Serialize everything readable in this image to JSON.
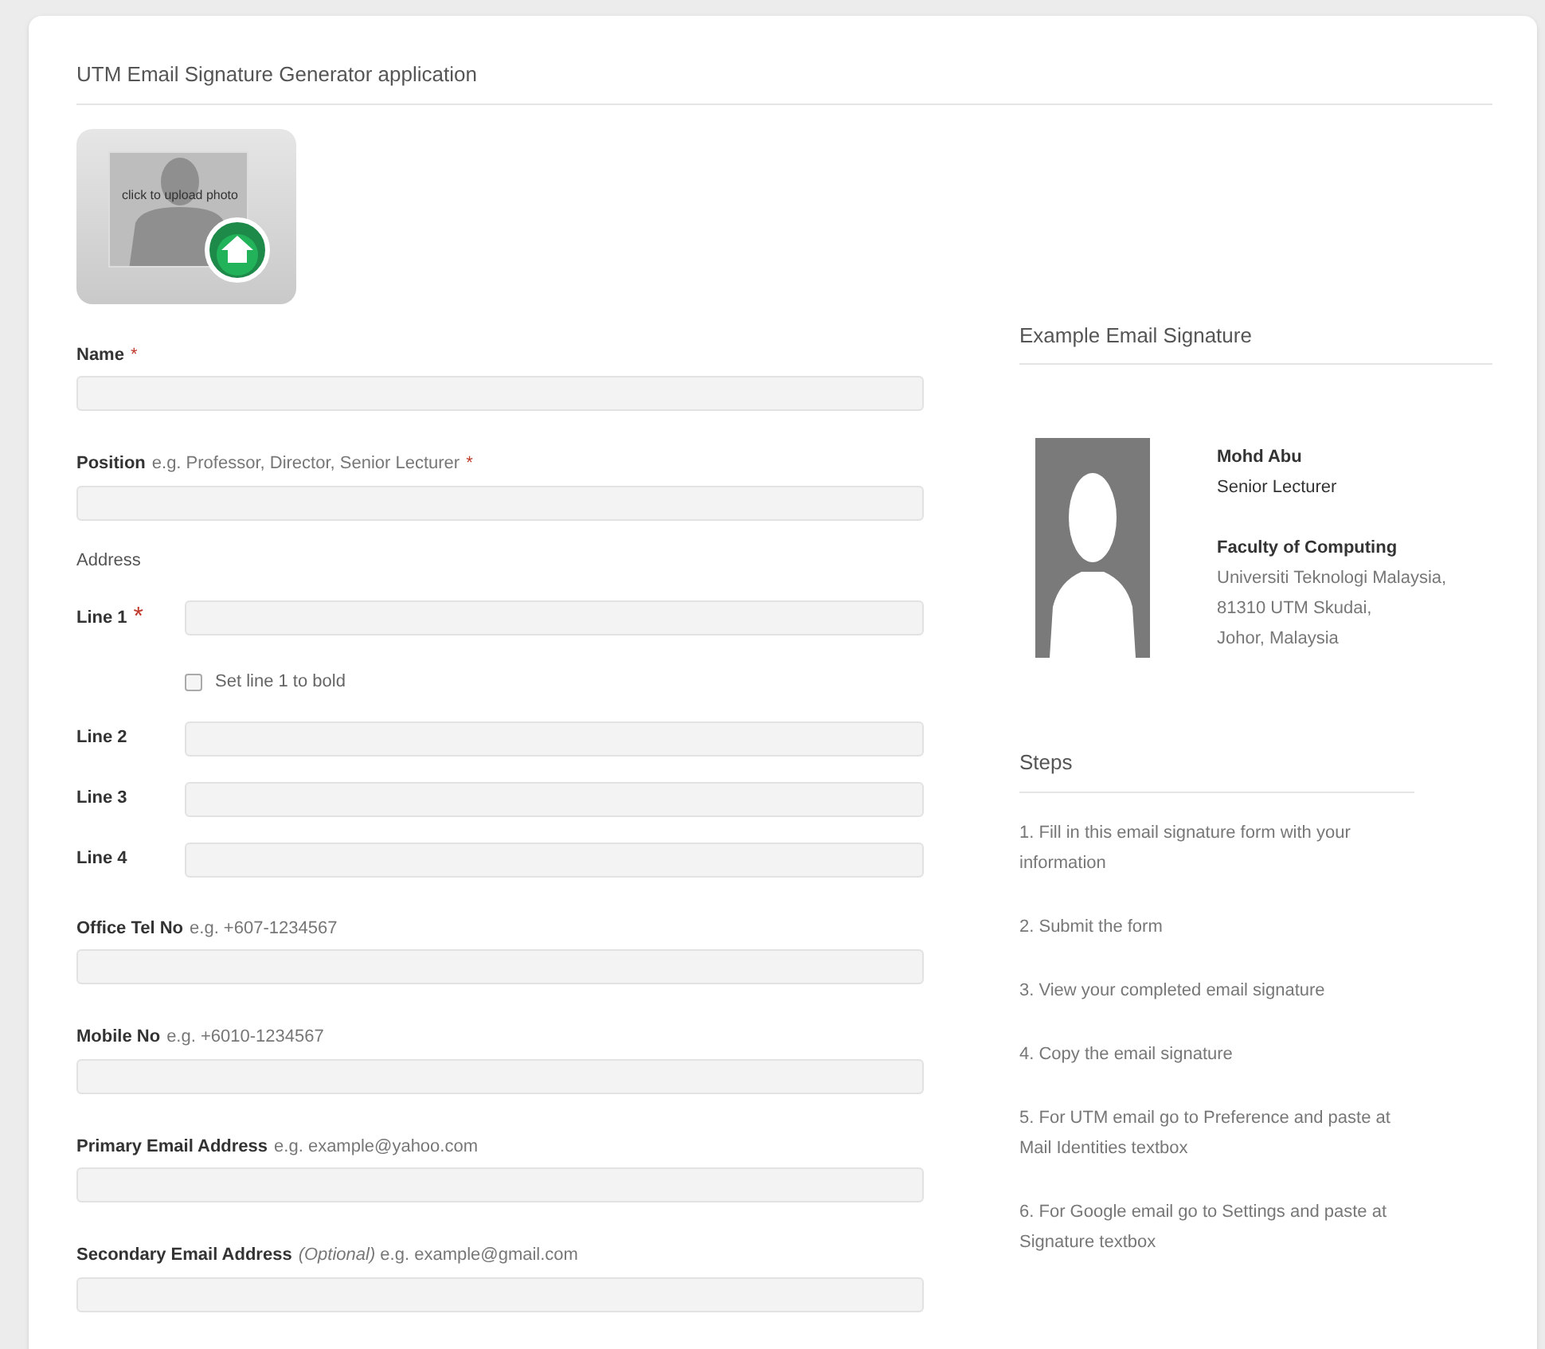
{
  "title": "UTM Email Signature Generator application",
  "upload": {
    "caption": "click to upload photo"
  },
  "fields": [
    {
      "kind": "stacked",
      "label": "Name",
      "mark": "*"
    },
    {
      "kind": "stacked",
      "label": "Position",
      "hint": "e.g. Professor, Director, Senior Lecturer",
      "mark": "*"
    },
    {
      "kind": "heading",
      "label": "Address"
    },
    {
      "kind": "inline",
      "label": "Line 1",
      "mark": "*"
    },
    {
      "kind": "checkbox",
      "label": "Set line 1 to bold",
      "checked": false
    },
    {
      "kind": "inline",
      "label": "Line 2"
    },
    {
      "kind": "inline",
      "label": "Line 3"
    },
    {
      "kind": "inline",
      "label": "Line 4"
    },
    {
      "kind": "stacked",
      "label": "Office Tel No",
      "hint": "e.g. +607-1234567"
    },
    {
      "kind": "stacked",
      "label": "Mobile No",
      "hint": "e.g. +6010-1234567"
    },
    {
      "kind": "stacked",
      "label": "Primary Email Address",
      "hint": "e.g. example@yahoo.com"
    },
    {
      "kind": "stacked",
      "label": "Secondary Email Address",
      "hint": "*(Optional)* e.g. example@gmail.com"
    }
  ],
  "example": {
    "heading": "Example Email Signature",
    "lines": [
      {
        "kind": "bold",
        "text": "Mohd Abu"
      },
      {
        "kind": "plain",
        "text": "Senior Lecturer"
      },
      {
        "kind": "gap"
      },
      {
        "kind": "bold",
        "text": "Faculty of Computing"
      },
      {
        "kind": "muted",
        "text": "Universiti Teknologi Malaysia,"
      },
      {
        "kind": "muted",
        "text": "81310 UTM Skudai,"
      },
      {
        "kind": "muted",
        "text": "Johor, Malaysia"
      }
    ]
  },
  "steps": {
    "heading": "Steps",
    "items": [
      "1. Fill in this email signature form with your information",
      "2. Submit the form",
      "3. View your completed email signature",
      "4. Copy the email signature",
      "5. For UTM email go to Preference and paste at Mail Identities textbox",
      "6. For Google email go to Settings and paste at Signature textbox"
    ]
  }
}
